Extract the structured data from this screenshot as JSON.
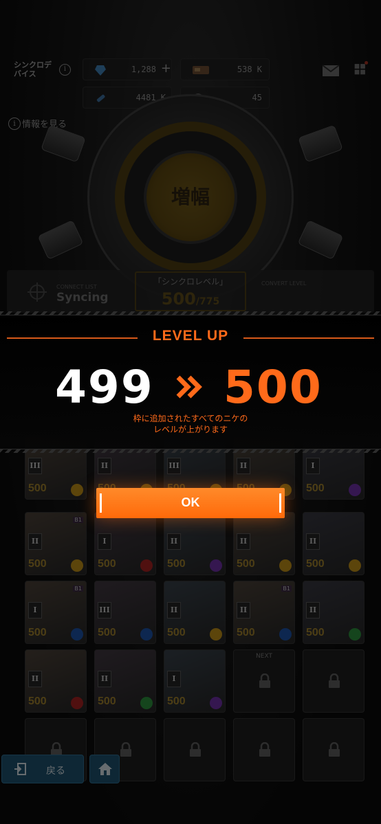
{
  "header": {
    "title": "シンクロデバイス",
    "info_link": "情報を見る",
    "resources": [
      {
        "icon": "gem-icon",
        "value": "1,288"
      },
      {
        "icon": "credit-card-icon",
        "value": "538 K"
      },
      {
        "icon": "core-dust-icon",
        "value": "4481 K"
      },
      {
        "icon": "body-label-icon",
        "value": "45"
      }
    ]
  },
  "device": {
    "amp_label": "増幅"
  },
  "sync_bar": {
    "connect_small": "CONNECT LIST",
    "connect_status": "Syncing",
    "level_title": "「シンクロレベル」",
    "level_value": "500",
    "level_max": "/775",
    "convert_small": "CONVERT LEVEL"
  },
  "grid": {
    "cards": [
      {
        "rank": "III",
        "level": "500",
        "class_color": "#b98a16"
      },
      {
        "rank": "II",
        "level": "500",
        "class_color": "#b98a16"
      },
      {
        "rank": "III",
        "level": "500",
        "class_color": "#b98a16"
      },
      {
        "rank": "II",
        "level": "500",
        "class_color": "#b98a16"
      },
      {
        "rank": "I",
        "level": "500",
        "class_color": "#6b2fa0"
      },
      {
        "rank": "II",
        "level": "500",
        "class_color": "#b98a16",
        "badge": "B1"
      },
      {
        "rank": "I",
        "level": "500",
        "class_color": "#a02020"
      },
      {
        "rank": "II",
        "level": "500",
        "class_color": "#6b2fa0"
      },
      {
        "rank": "II",
        "level": "500",
        "class_color": "#b98a16"
      },
      {
        "rank": "II",
        "level": "500",
        "class_color": "#b98a16"
      },
      {
        "rank": "I",
        "level": "500",
        "class_color": "#1a4fa0",
        "badge": "B1"
      },
      {
        "rank": "III",
        "level": "500",
        "class_color": "#1a4fa0"
      },
      {
        "rank": "II",
        "level": "500",
        "class_color": "#b98a16"
      },
      {
        "rank": "II",
        "level": "500",
        "class_color": "#1a4fa0",
        "badge": "B1"
      },
      {
        "rank": "II",
        "level": "500",
        "class_color": "#2a8a3a"
      },
      {
        "rank": "II",
        "level": "500",
        "class_color": "#a02020"
      },
      {
        "rank": "II",
        "level": "500",
        "class_color": "#2a8a3a"
      },
      {
        "rank": "I",
        "level": "500",
        "class_color": "#6b2fa0"
      }
    ],
    "next_label": "NEXT"
  },
  "bottom": {
    "back_label": "戻る"
  },
  "level_up": {
    "title": "LEVEL UP",
    "old_level": "499",
    "new_level": "500",
    "description_line1": "枠に追加されたすべてのニケの",
    "description_line2": "レベルが上がります",
    "ok_label": "OK",
    "accent_color": "#ff6a1a"
  }
}
